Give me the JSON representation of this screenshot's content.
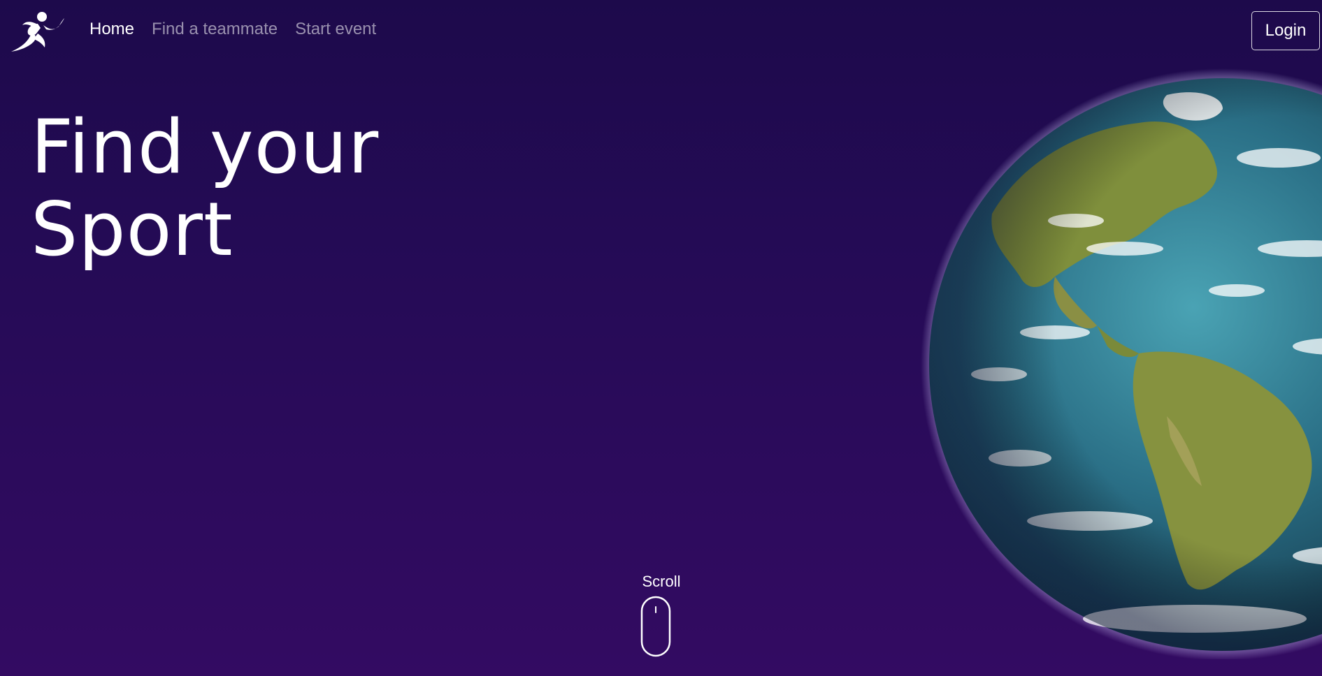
{
  "nav": {
    "logo_icon": "runner-icon",
    "links": [
      {
        "label": "Home",
        "active": true
      },
      {
        "label": "Find a teammate",
        "active": false
      },
      {
        "label": "Start event",
        "active": false
      }
    ],
    "login_label": "Login"
  },
  "hero": {
    "title_line1": "Find your",
    "title_line2": "Sport"
  },
  "scroll": {
    "label": "Scroll",
    "icon": "mouse-icon"
  },
  "globe": {
    "icon": "earth-globe-image"
  },
  "colors": {
    "background_top": "#1d0a4b",
    "background_bottom": "#330b62",
    "text": "#ffffff",
    "muted_link": "#a79dbf",
    "ocean": "#2a6f86",
    "land": "#7f8f3c"
  }
}
